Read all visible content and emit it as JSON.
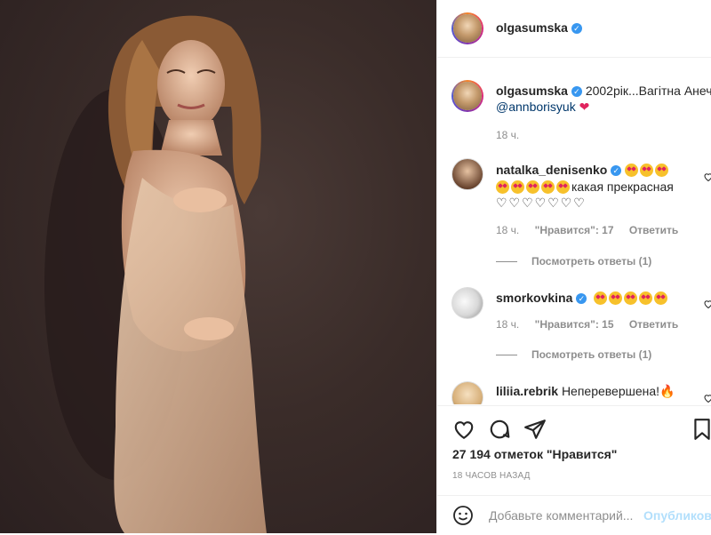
{
  "header": {
    "username": "olgasumska",
    "verified_mark": "✓"
  },
  "caption": {
    "username": "olgasumska",
    "verified_mark": "✓",
    "text": "2002рік...Вагітна Анеч",
    "mention": "@annborisyuk",
    "heart": "❤",
    "time": "18 ч."
  },
  "comments": [
    {
      "username": "natalka_denisenko",
      "verified_mark": "✓",
      "line2_text": "какая прекрасная",
      "outline_hearts": "♡♡♡♡♡♡♡",
      "time": "18 ч.",
      "likes": "\"Нравится\": 17",
      "reply": "Ответить",
      "view_replies": "Посмотреть ответы (1)"
    },
    {
      "username": "smorkovkina",
      "verified_mark": "✓",
      "time": "18 ч.",
      "likes": "\"Нравится\": 15",
      "reply": "Ответить",
      "view_replies": "Посмотреть ответы (1)"
    },
    {
      "username": "liliia.rebrik",
      "text": "Неперевершена!",
      "fire": "🔥"
    }
  ],
  "likes": {
    "count": "27 194 отметок \"Нравится\""
  },
  "ago": "18 ЧАСОВ НАЗАД",
  "add_comment": {
    "placeholder": "Добавьте комментарий...",
    "publish": "Опубликовать"
  },
  "icons": [
    "heart-icon",
    "comment-icon",
    "share-icon",
    "bookmark-icon",
    "smile-icon"
  ]
}
